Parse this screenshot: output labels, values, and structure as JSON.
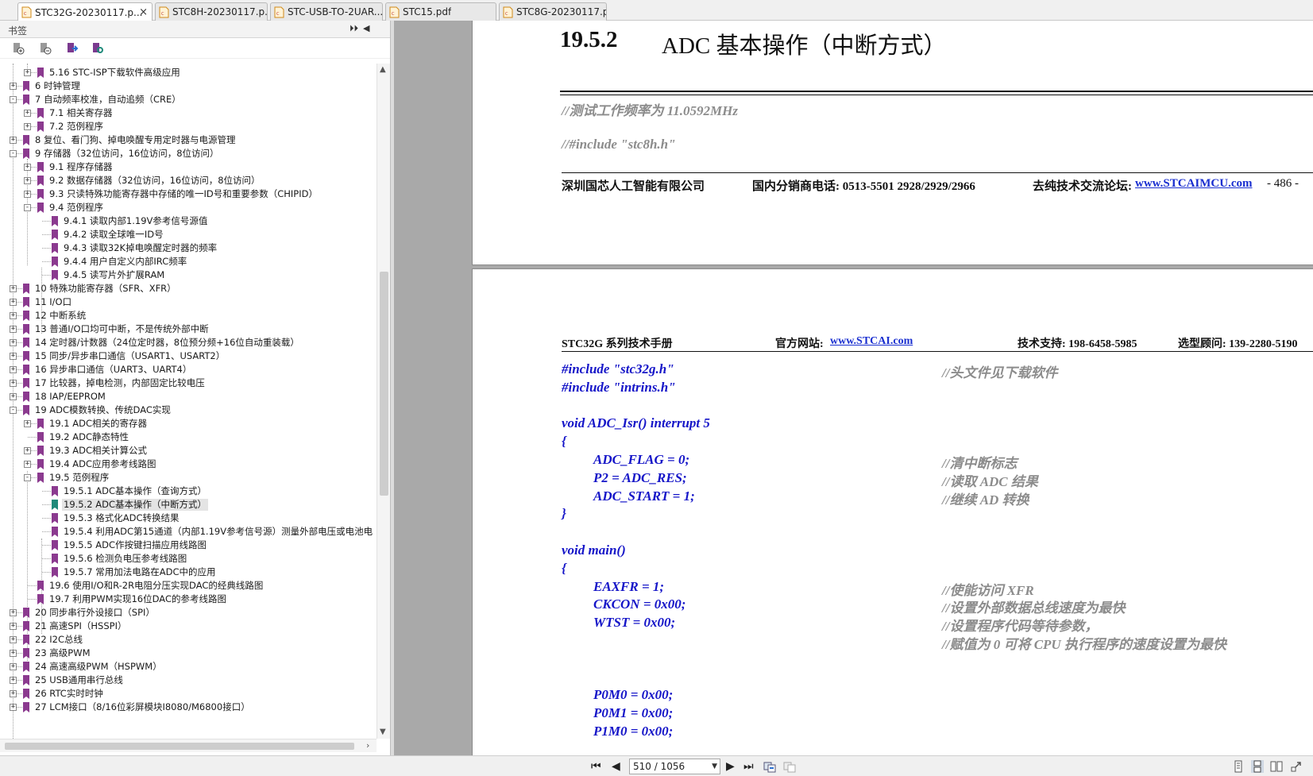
{
  "tabs": [
    {
      "label": "STC32G-20230117.p...",
      "active": true
    },
    {
      "label": "STC8H-20230117.p..."
    },
    {
      "label": "STC-USB-TO-2UAR..."
    },
    {
      "label": "STC15.pdf"
    },
    {
      "label": "STC8G-20230117.p..."
    }
  ],
  "panel": {
    "title": "书签",
    "bookmarks": [
      {
        "label": "5.16 STC-ISP下载软件高级应用",
        "level": 1,
        "exp": "+"
      },
      {
        "label": "6 时钟管理",
        "level": 0,
        "exp": "+"
      },
      {
        "label": "7 自动频率校准，自动追频（CRE）",
        "level": 0,
        "exp": "-"
      },
      {
        "label": "7.1 相关寄存器",
        "level": 1,
        "exp": "+"
      },
      {
        "label": "7.2 范例程序",
        "level": 1,
        "exp": "+"
      },
      {
        "label": "8 复位、看门狗、掉电唤醒专用定时器与电源管理",
        "level": 0,
        "exp": "+"
      },
      {
        "label": "9 存储器（32位访问，16位访问，8位访问）",
        "level": 0,
        "exp": "-"
      },
      {
        "label": "9.1 程序存储器",
        "level": 1,
        "exp": "+"
      },
      {
        "label": "9.2 数据存储器（32位访问，16位访问，8位访问）",
        "level": 1,
        "exp": "+"
      },
      {
        "label": "9.3 只读特殊功能寄存器中存储的唯一ID号和重要参数（CHIPID）",
        "level": 1,
        "exp": "+"
      },
      {
        "label": "9.4 范例程序",
        "level": 1,
        "exp": "-"
      },
      {
        "label": "9.4.1 读取内部1.19V参考信号源值",
        "level": 2
      },
      {
        "label": "9.4.2 读取全球唯一ID号",
        "level": 2
      },
      {
        "label": "9.4.3 读取32K掉电唤醒定时器的频率",
        "level": 2
      },
      {
        "label": "9.4.4 用户自定义内部IRC频率",
        "level": 2
      },
      {
        "label": "9.4.5 读写片外扩展RAM",
        "level": 2
      },
      {
        "label": "10 特殊功能寄存器（SFR、XFR）",
        "level": 0,
        "exp": "+"
      },
      {
        "label": "11 I/O口",
        "level": 0,
        "exp": "+"
      },
      {
        "label": "12 中断系统",
        "level": 0,
        "exp": "+"
      },
      {
        "label": "13 普通I/O口均可中断，不是传统外部中断",
        "level": 0,
        "exp": "+"
      },
      {
        "label": "14 定时器/计数器（24位定时器，8位预分频+16位自动重装载）",
        "level": 0,
        "exp": "+"
      },
      {
        "label": "15 同步/异步串口通信（USART1、USART2）",
        "level": 0,
        "exp": "+"
      },
      {
        "label": "16 异步串口通信（UART3、UART4）",
        "level": 0,
        "exp": "+"
      },
      {
        "label": "17 比较器，掉电检测，内部固定比较电压",
        "level": 0,
        "exp": "+"
      },
      {
        "label": "18 IAP/EEPROM",
        "level": 0,
        "exp": "+"
      },
      {
        "label": "19 ADC模数转换、传统DAC实现",
        "level": 0,
        "exp": "-"
      },
      {
        "label": "19.1 ADC相关的寄存器",
        "level": 1,
        "exp": "+"
      },
      {
        "label": "19.2 ADC静态特性",
        "level": 1
      },
      {
        "label": "19.3 ADC相关计算公式",
        "level": 1,
        "exp": "+"
      },
      {
        "label": "19.4 ADC应用参考线路图",
        "level": 1,
        "exp": "+"
      },
      {
        "label": "19.5 范例程序",
        "level": 1,
        "exp": "-"
      },
      {
        "label": "19.5.1 ADC基本操作（查询方式）",
        "level": 2
      },
      {
        "label": "19.5.2 ADC基本操作（中断方式）",
        "level": 2,
        "selected": true
      },
      {
        "label": "19.5.3 格式化ADC转换结果",
        "level": 2
      },
      {
        "label": "19.5.4 利用ADC第15通道（内部1.19V参考信号源）测量外部电压或电池电",
        "level": 2
      },
      {
        "label": "19.5.5 ADC作按键扫描应用线路图",
        "level": 2
      },
      {
        "label": "19.5.6 检测负电压参考线路图",
        "level": 2
      },
      {
        "label": "19.5.7 常用加法电路在ADC中的应用",
        "level": 2
      },
      {
        "label": "19.6 使用I/O和R-2R电阻分压实现DAC的经典线路图",
        "level": 1
      },
      {
        "label": "19.7 利用PWM实现16位DAC的参考线路图",
        "level": 1
      },
      {
        "label": "20 同步串行外设接口（SPI）",
        "level": 0,
        "exp": "+"
      },
      {
        "label": "21 高速SPI（HSSPI）",
        "level": 0,
        "exp": "+"
      },
      {
        "label": "22 I2C总线",
        "level": 0,
        "exp": "+"
      },
      {
        "label": "23 高级PWM",
        "level": 0,
        "exp": "+"
      },
      {
        "label": "24 高速高级PWM（HSPWM）",
        "level": 0,
        "exp": "+"
      },
      {
        "label": "25 USB通用串行总线",
        "level": 0,
        "exp": "+"
      },
      {
        "label": "26 RTC实时时钟",
        "level": 0,
        "exp": "+"
      },
      {
        "label": "27 LCM接口（8/16位彩屏模块I8080/M6800接口）",
        "level": 0,
        "exp": "+"
      }
    ]
  },
  "page1": {
    "section_number": "19.5.2",
    "section_title": "ADC 基本操作（中断方式）",
    "comment_freq": "//测试工作频率为 11.0592MHz",
    "comment_include": "//#include \"stc8h.h\"",
    "footer_company": "深圳国芯人工智能有限公司",
    "footer_phone": "国内分销商电话: 0513-5501 2928/2929/2966",
    "footer_forum_label": "去纯技术交流论坛:",
    "footer_forum_url": "www.STCAIMCU.com",
    "footer_page": "- 486 -"
  },
  "page2": {
    "header_manual": "STC32G 系列技术手册",
    "header_site_label": "官方网站: ",
    "header_site_url": "www.STCAI.com",
    "header_support": "技术支持: 198-6458-5985",
    "header_consult": "选型顾问: 139-2280-5190",
    "code_lines": [
      {
        "code": "#include \"stc32g.h\"",
        "indent": 0,
        "comment": "//头文件见下载软件"
      },
      {
        "code": "#include \"intrins.h\"",
        "indent": 0,
        "comment": ""
      },
      {
        "code": "",
        "indent": 0,
        "comment": ""
      },
      {
        "code": "void ADC_Isr() interrupt 5",
        "indent": 0,
        "comment": ""
      },
      {
        "code": "{",
        "indent": 0,
        "comment": ""
      },
      {
        "code": "ADC_FLAG = 0;",
        "indent": 1,
        "comment": "//清中断标志"
      },
      {
        "code": "P2 = ADC_RES;",
        "indent": 1,
        "comment": "//读取 ADC 结果"
      },
      {
        "code": "ADC_START = 1;",
        "indent": 1,
        "comment": "//继续 AD 转换"
      },
      {
        "code": "}",
        "indent": 0,
        "comment": ""
      },
      {
        "code": "",
        "indent": 0,
        "comment": ""
      },
      {
        "code": "void main()",
        "indent": 0,
        "comment": ""
      },
      {
        "code": "{",
        "indent": 0,
        "comment": ""
      },
      {
        "code": "EAXFR = 1;",
        "indent": 1,
        "comment": "//使能访问 XFR"
      },
      {
        "code": "CKCON = 0x00;",
        "indent": 1,
        "comment": "//设置外部数据总线速度为最快"
      },
      {
        "code": "WTST = 0x00;",
        "indent": 1,
        "comment": "//设置程序代码等待参数，"
      },
      {
        "code": "",
        "indent": 1,
        "comment": "//赋值为 0 可将 CPU 执行程序的速度设置为最快"
      },
      {
        "code": "",
        "indent": 0,
        "comment": ""
      },
      {
        "code": "",
        "indent": 0,
        "comment": ""
      },
      {
        "code": "P0M0 = 0x00;",
        "indent": 1,
        "comment": ""
      },
      {
        "code": "P0M1 = 0x00;",
        "indent": 1,
        "comment": ""
      },
      {
        "code": "P1M0 = 0x00;",
        "indent": 1,
        "comment": ""
      }
    ]
  },
  "bottom": {
    "page_indicator": "510 / 1056"
  },
  "colors": {
    "bookmark": "#8b3a8f",
    "bookmark_selected": "#1f8a7a",
    "code": "#1515c8",
    "comment": "#8c8c8c",
    "link": "#1a2fd0"
  }
}
